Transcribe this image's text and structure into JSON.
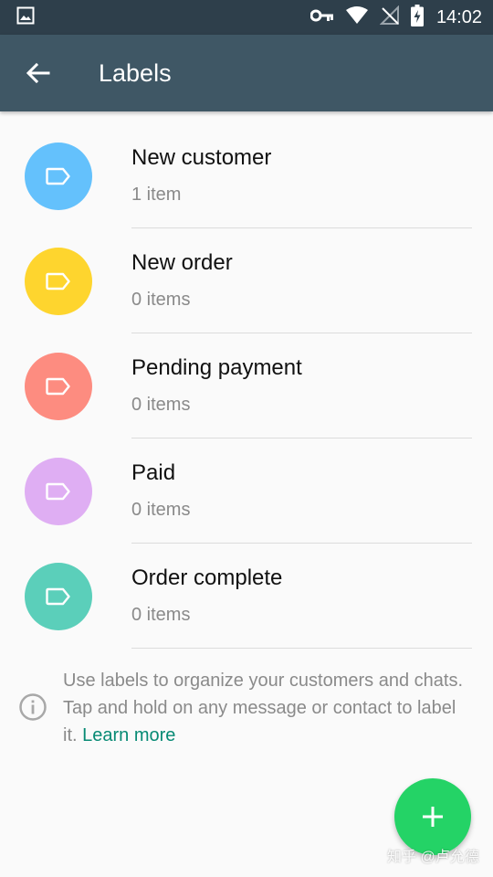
{
  "status_bar": {
    "time": "14:02",
    "icons": [
      "image-icon",
      "key-icon",
      "wifi-icon",
      "no-signal-icon",
      "battery-charging-icon"
    ]
  },
  "app_bar": {
    "title": "Labels",
    "back_icon": "arrow-back-icon"
  },
  "labels": [
    {
      "name": "New customer",
      "count": "1 item",
      "color": "#64c1fc"
    },
    {
      "name": "New order",
      "count": "0 items",
      "color": "#fed52e"
    },
    {
      "name": "Pending payment",
      "count": "0 items",
      "color": "#fd8c80"
    },
    {
      "name": "Paid",
      "count": "0 items",
      "color": "#dfaef3"
    },
    {
      "name": "Order complete",
      "count": "0 items",
      "color": "#5bcfba"
    }
  ],
  "info": {
    "text": "Use labels to organize your customers and chats. Tap and hold on any message or contact to label it.",
    "link": "Learn more",
    "icon": "info-icon"
  },
  "fab": {
    "icon": "plus-icon",
    "color": "#24d366"
  },
  "watermark": "知乎 @卢允德",
  "colors": {
    "status_bar": "#2e3f4b",
    "app_bar": "#3f5765",
    "link": "#078a74",
    "background": "#fafafa"
  }
}
